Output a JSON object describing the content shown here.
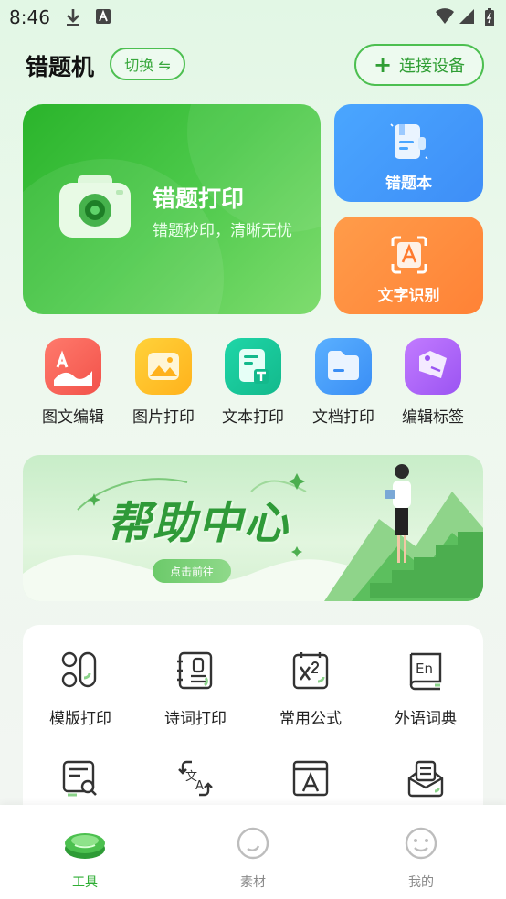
{
  "status_bar": {
    "time": "8:46"
  },
  "header": {
    "title": "错题机",
    "switch_label": "切换 ⇋",
    "connect_label": "连接设备"
  },
  "cards": {
    "print": {
      "title": "错题打印",
      "subtitle": "错题秒印，清晰无忧"
    },
    "book": {
      "label": "错题本"
    },
    "ocr": {
      "label": "文字识别"
    }
  },
  "tools": [
    {
      "label": "图文编辑",
      "icon": "image-text-edit-icon"
    },
    {
      "label": "图片打印",
      "icon": "image-print-icon"
    },
    {
      "label": "文本打印",
      "icon": "text-print-icon"
    },
    {
      "label": "文档打印",
      "icon": "document-print-icon"
    },
    {
      "label": "编辑标签",
      "icon": "label-edit-icon"
    }
  ],
  "banner": {
    "title": "帮助中心",
    "button_label": "点击前往"
  },
  "grid": [
    {
      "label": "模版打印",
      "icon": "template-icon"
    },
    {
      "label": "诗词打印",
      "icon": "poetry-icon"
    },
    {
      "label": "常用公式",
      "icon": "formula-icon"
    },
    {
      "label": "外语词典",
      "icon": "dictionary-icon"
    },
    {
      "label": "",
      "icon": "document-search-icon"
    },
    {
      "label": "",
      "icon": "translate-icon"
    },
    {
      "label": "",
      "icon": "font-icon"
    },
    {
      "label": "",
      "icon": "message-box-icon"
    }
  ],
  "bottom_nav": [
    {
      "label": "工具",
      "active": true
    },
    {
      "label": "素材",
      "active": false
    },
    {
      "label": "我的",
      "active": false
    }
  ],
  "colors": {
    "accent": "#2fae34",
    "blue_card": "#3e8ef7",
    "orange_card": "#ff8236"
  }
}
